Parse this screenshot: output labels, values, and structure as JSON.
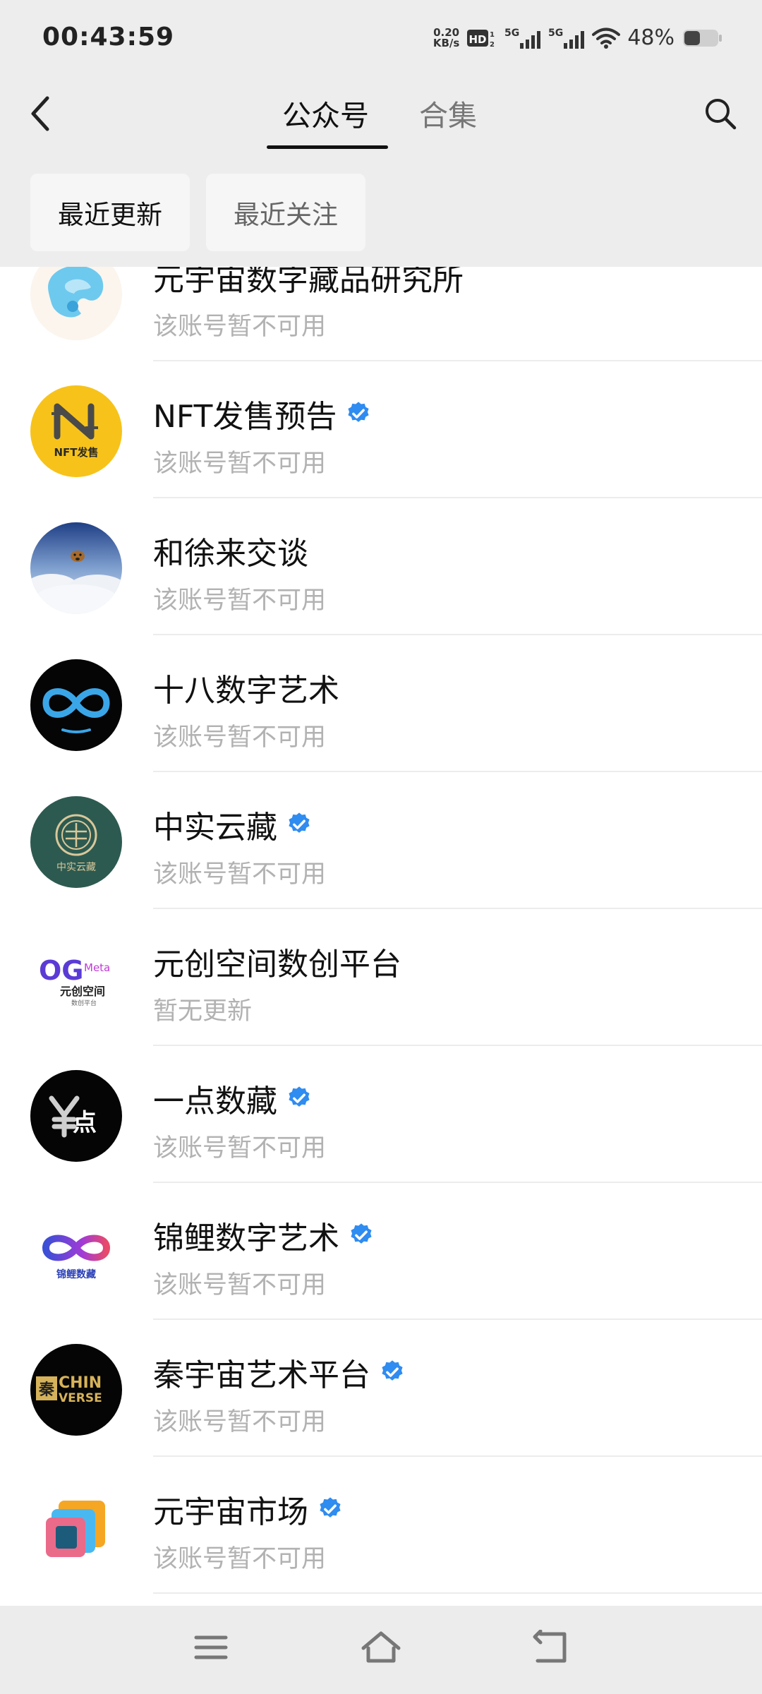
{
  "status_bar": {
    "time": "00:43:59",
    "net_speed_value": "0.20",
    "net_speed_unit": "KB/s",
    "hd_label": "HD",
    "sim1_label": "5G",
    "sim2_label": "5G",
    "battery_percent": "48%",
    "battery_level": 0.48
  },
  "nav": {
    "tabs": [
      {
        "label": "公众号",
        "active": true
      },
      {
        "label": "合集",
        "active": false
      }
    ]
  },
  "filters": [
    {
      "label": "最近更新",
      "active": true
    },
    {
      "label": "最近关注",
      "active": false
    }
  ],
  "list": {
    "items": [
      {
        "title": "元宇宙数字藏品研究所",
        "subtitle": "该账号暂不可用",
        "verified": false,
        "avatar": "blue-abstract-avatar"
      },
      {
        "title": "NFT发售预告",
        "subtitle": "该账号暂不可用",
        "verified": true,
        "avatar": "nft-yellow-logo-avatar"
      },
      {
        "title": "和徐来交谈",
        "subtitle": "该账号暂不可用",
        "verified": false,
        "avatar": "dog-on-cloud-avatar"
      },
      {
        "title": "十八数字艺术",
        "subtitle": "该账号暂不可用",
        "verified": false,
        "avatar": "infinity-logo-avatar"
      },
      {
        "title": "中实云藏",
        "subtitle": "该账号暂不可用",
        "verified": true,
        "avatar": "green-seal-avatar"
      },
      {
        "title": "元创空间数创平台",
        "subtitle": "暂无更新",
        "verified": false,
        "avatar": "og-meta-logo-avatar"
      },
      {
        "title": "一点数藏",
        "subtitle": "该账号暂不可用",
        "verified": true,
        "avatar": "yidian-logo-avatar"
      },
      {
        "title": "锦鲤数字艺术",
        "subtitle": "该账号暂不可用",
        "verified": true,
        "avatar": "koi-infinity-logo-avatar"
      },
      {
        "title": "秦宇宙艺术平台",
        "subtitle": "该账号暂不可用",
        "verified": true,
        "avatar": "chinverse-logo-avatar"
      },
      {
        "title": "元宇宙市场",
        "subtitle": "该账号暂不可用",
        "verified": true,
        "avatar": "colorful-cards-avatar"
      }
    ]
  },
  "avatar_text": {
    "nft": "NFT发售",
    "zhongshi": "中实云藏",
    "og": "OG",
    "meta": "Meta",
    "yuanchuang": "元创空间",
    "shuchuang": "数创平台",
    "yidian": "点",
    "koi": "锦鲤数藏",
    "qin": "秦",
    "chin": "CHIN",
    "verse": "VERSE"
  },
  "icons": {
    "back": "chevron-left-icon",
    "search": "search-icon",
    "verified": "verified-badge-icon",
    "menu": "menu-icon",
    "home": "home-icon",
    "return": "return-icon"
  },
  "colors": {
    "header_bg": "#ededed",
    "verified_blue": "#2f8cf0",
    "subtitle_gray": "#b2b2b2"
  }
}
